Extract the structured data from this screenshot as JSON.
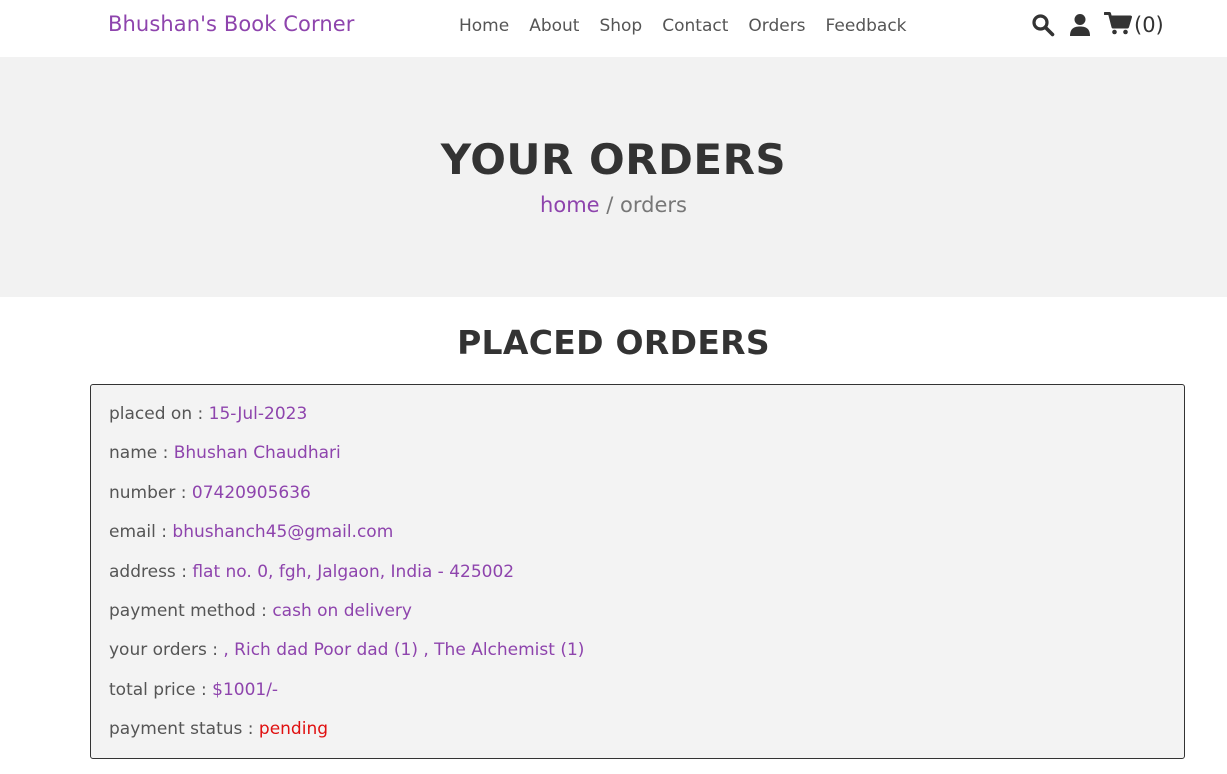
{
  "header": {
    "logo": "Bhushan's Book Corner",
    "nav": [
      "Home",
      "About",
      "Shop",
      "Contact",
      "Orders",
      "Feedback"
    ],
    "icons": [
      "search-icon",
      "user-icon",
      "cart-icon"
    ],
    "cart_count": "(0)"
  },
  "hero": {
    "title": "YOUR ORDERS",
    "breadcrumb_home": "home",
    "breadcrumb_sep": " / ",
    "breadcrumb_current": "orders"
  },
  "section": {
    "title": "PLACED ORDERS"
  },
  "order": {
    "rows": [
      {
        "label": "placed on : ",
        "value": "15-Jul-2023"
      },
      {
        "label": "name : ",
        "value": "Bhushan Chaudhari"
      },
      {
        "label": "number : ",
        "value": "07420905636"
      },
      {
        "label": "email : ",
        "value": "bhushanch45@gmail.com"
      },
      {
        "label": "address : ",
        "value": "flat no. 0, fgh, Jalgaon, India - 425002"
      },
      {
        "label": "payment method : ",
        "value": "cash on delivery"
      },
      {
        "label": "your orders : ",
        "value": ", Rich dad Poor dad (1) , The Alchemist (1)"
      },
      {
        "label": "total price : ",
        "value": "$1001/-"
      },
      {
        "label": "payment status : ",
        "value": "pending"
      }
    ]
  },
  "colors": {
    "accent": "#8e44ad",
    "status_pending": "#e01010",
    "hero_bg": "#f2f2f2",
    "box_bg": "#f3f3f3"
  }
}
